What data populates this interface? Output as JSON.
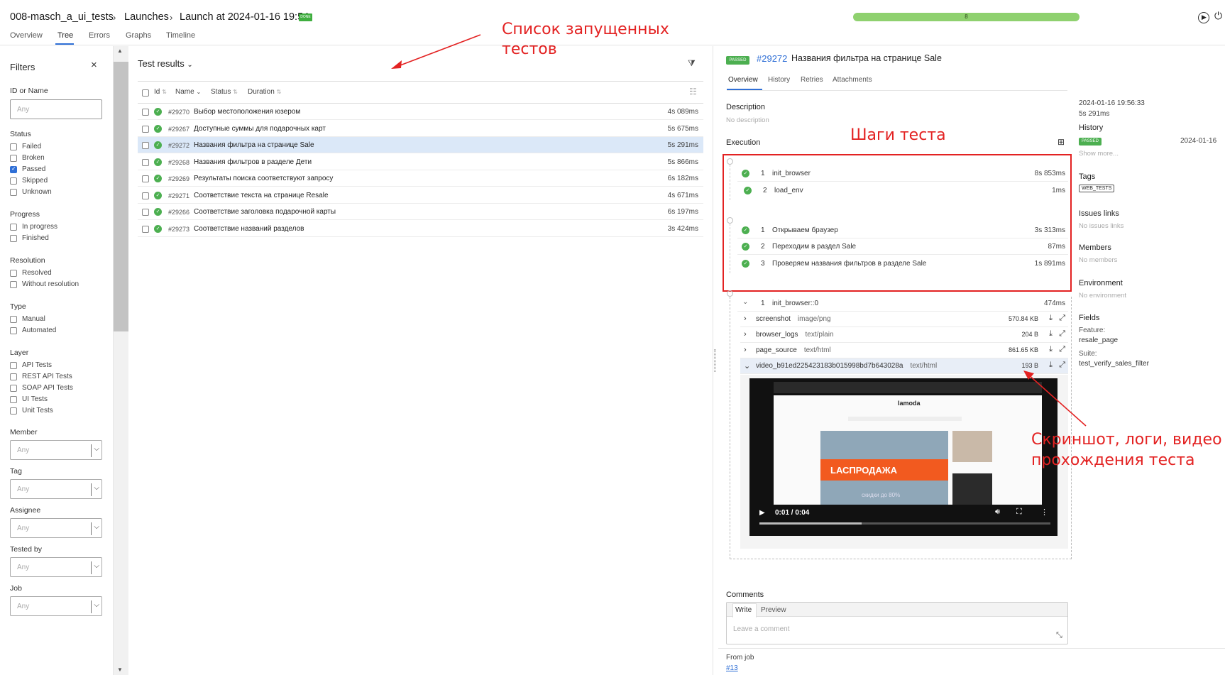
{
  "breadcrumb": {
    "project": "008-masch_a_ui_tests",
    "launches": "Launches",
    "launch": "Launch at 2024-01-16 19:54",
    "badge": "DONE"
  },
  "tabs": [
    "Overview",
    "Tree",
    "Errors",
    "Graphs",
    "Timeline"
  ],
  "progress": {
    "value": "8",
    "fraction": 1.0
  },
  "filters": {
    "title": "Filters",
    "close": "×",
    "id_label": "ID or Name",
    "id_placeholder": "Any",
    "status": {
      "label": "Status",
      "items": [
        "Failed",
        "Broken",
        "Passed",
        "Skipped",
        "Unknown"
      ],
      "checked": "Passed"
    },
    "progress": {
      "label": "Progress",
      "items": [
        "In progress",
        "Finished"
      ]
    },
    "resolution": {
      "label": "Resolution",
      "items": [
        "Resolved",
        "Without resolution"
      ]
    },
    "type": {
      "label": "Type",
      "items": [
        "Manual",
        "Automated"
      ]
    },
    "layer": {
      "label": "Layer",
      "items": [
        "API Tests",
        "REST API Tests",
        "SOAP API Tests",
        "UI Tests",
        "Unit Tests"
      ]
    },
    "selects": [
      {
        "label": "Member",
        "placeholder": "Any"
      },
      {
        "label": "Tag",
        "placeholder": "Any"
      },
      {
        "label": "Assignee",
        "placeholder": "Any"
      },
      {
        "label": "Tested by",
        "placeholder": "Any"
      },
      {
        "label": "Job",
        "placeholder": "Any"
      }
    ]
  },
  "tests": {
    "title": "Test results",
    "columns": {
      "id": "Id",
      "name": "Name",
      "status": "Status",
      "duration": "Duration"
    },
    "rows": [
      {
        "id": "#29270",
        "name": "Выбор местоположения юзером",
        "duration": "4s 089ms"
      },
      {
        "id": "#29267",
        "name": "Доступные суммы для подарочных карт",
        "duration": "5s 675ms"
      },
      {
        "id": "#29272",
        "name": "Названия фильтра на странице Sale",
        "duration": "5s 291ms"
      },
      {
        "id": "#29268",
        "name": "Названия фильтров в разделе Дети",
        "duration": "5s 866ms"
      },
      {
        "id": "#29269",
        "name": "Результаты поиска соответствуют запросу",
        "duration": "6s 182ms"
      },
      {
        "id": "#29271",
        "name": "Соответствие текста на странице Resale",
        "duration": "4s 671ms"
      },
      {
        "id": "#29266",
        "name": "Соответствие заголовка подарочной карты",
        "duration": "6s 197ms"
      },
      {
        "id": "#29273",
        "name": "Соответствие названий разделов",
        "duration": "3s 424ms"
      }
    ]
  },
  "detail": {
    "badge": "PASSED",
    "id": "#29272",
    "title": "Названия фильтра на странице Sale",
    "tabs": [
      "Overview",
      "History",
      "Retries",
      "Attachments"
    ],
    "description_label": "Description",
    "description": "No description",
    "execution_label": "Execution",
    "setup_steps": [
      {
        "num": "1",
        "name": "init_browser",
        "duration": "8s 853ms"
      },
      {
        "num": "2",
        "name": "load_env",
        "duration": "1ms"
      }
    ],
    "test_steps": [
      {
        "num": "1",
        "name": "Открываем браузер",
        "duration": "3s 313ms"
      },
      {
        "num": "2",
        "name": "Переходим в раздел Sale",
        "duration": "87ms"
      },
      {
        "num": "3",
        "name": "Проверяем названия фильтров в разделе Sale",
        "duration": "1s 891ms"
      }
    ],
    "teardown": {
      "num": "1",
      "name": "init_browser::0",
      "duration": "474ms"
    },
    "attachments": [
      {
        "name": "screenshot",
        "type": "image/png",
        "size": "570.84 KB"
      },
      {
        "name": "browser_logs",
        "type": "text/plain",
        "size": "204 B"
      },
      {
        "name": "page_source",
        "type": "text/html",
        "size": "861.65 KB"
      },
      {
        "name": "video_b91ed225423183b015998bd7b643028a",
        "type": "text/html",
        "size": "193 B"
      }
    ],
    "video": {
      "time": "0:01 / 0:04",
      "logo": "lamoda",
      "banner": "LАСПРОДАЖА",
      "sub": "скидки до 80%"
    },
    "comments_label": "Comments",
    "comment_tabs": [
      "Write",
      "Preview"
    ],
    "comment_placeholder": "Leave a comment",
    "from_job_label": "From job",
    "from_job": "#13"
  },
  "sidebar": {
    "datetime": "2024-01-16 19:56:33",
    "duration": "5s 291ms",
    "history_label": "History",
    "history_badge": "PASSED",
    "history_date": "2024-01-16",
    "show_more": "Show more...",
    "tags_label": "Tags",
    "tag": "WEB_TESTS",
    "issues_label": "Issues links",
    "issues": "No issues links",
    "members_label": "Members",
    "members": "No members",
    "env_label": "Environment",
    "env": "No environment",
    "fields_label": "Fields",
    "feature_label": "Feature:",
    "feature": "resale_page",
    "suite_label": "Suite:",
    "suite": "test_verify_sales_filter"
  },
  "annotations": {
    "tests_list": "Список запущенных тестов",
    "steps": "Шаги теста",
    "media": "Скриншот, логи, видео прохождения теста"
  },
  "colors": {
    "accent": "#2f6fd6",
    "passed": "#4caf50",
    "annotation": "#e32222",
    "selected_row": "#dbe8f8"
  }
}
